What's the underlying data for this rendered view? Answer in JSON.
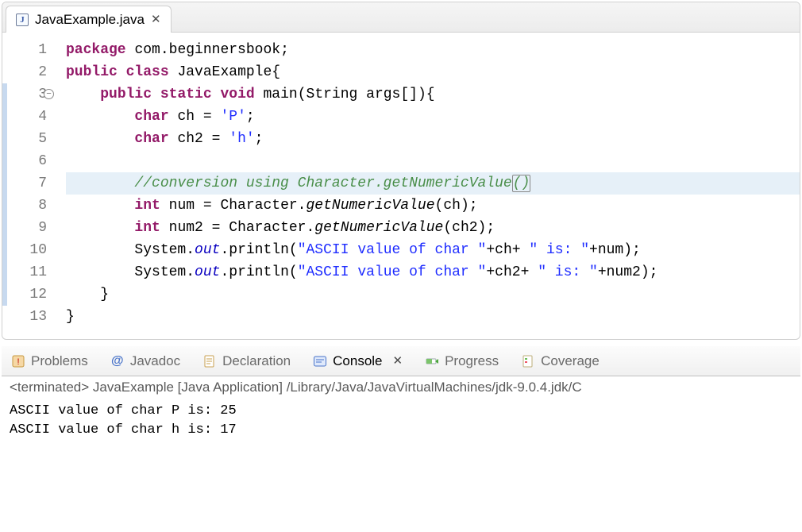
{
  "editor": {
    "tab": {
      "filename": "JavaExample.java"
    },
    "lines": [
      {
        "n": 1,
        "mark": false
      },
      {
        "n": 2,
        "mark": false
      },
      {
        "n": 3,
        "mark": true,
        "fold": true
      },
      {
        "n": 4,
        "mark": true
      },
      {
        "n": 5,
        "mark": true
      },
      {
        "n": 6,
        "mark": true
      },
      {
        "n": 7,
        "mark": true,
        "highlight": true
      },
      {
        "n": 8,
        "mark": true
      },
      {
        "n": 9,
        "mark": true
      },
      {
        "n": 10,
        "mark": true
      },
      {
        "n": 11,
        "mark": true
      },
      {
        "n": 12,
        "mark": true
      },
      {
        "n": 13,
        "mark": false
      }
    ],
    "tokens": {
      "package": "package",
      "pkgname": "com.beginnersbook",
      "public": "public",
      "class": "class",
      "classname": "JavaExample",
      "static": "static",
      "void": "void",
      "main": "main",
      "Stringargs": "String args[]",
      "char": "char",
      "int": "int",
      "ch": "ch",
      "ch2": "ch2",
      "num": "num",
      "num2": "num2",
      "eq": " = ",
      "Plit": "'P'",
      "hlit": "'h'",
      "comment7": "//conversion using Character.getNumericValue()",
      "Character": "Character",
      "getNumericValue": "getNumericValue",
      "System": "System",
      "out": "out",
      "println": "println",
      "strAscii": "\"ASCII value of char \"",
      "strIs": "\" is: \"",
      "plus": "+",
      "semi": ";",
      "ob": "{",
      "cb": "}",
      "op": "(",
      "cp": ")",
      "dot": "."
    }
  },
  "views": {
    "problems": "Problems",
    "javadoc": "Javadoc",
    "declaration": "Declaration",
    "console": "Console",
    "progress": "Progress",
    "coverage": "Coverage"
  },
  "console": {
    "status": "<terminated> JavaExample [Java Application] /Library/Java/JavaVirtualMachines/jdk-9.0.4.jdk/C",
    "line1": "ASCII value of char P is: 25",
    "line2": "ASCII value of char h is: 17"
  }
}
